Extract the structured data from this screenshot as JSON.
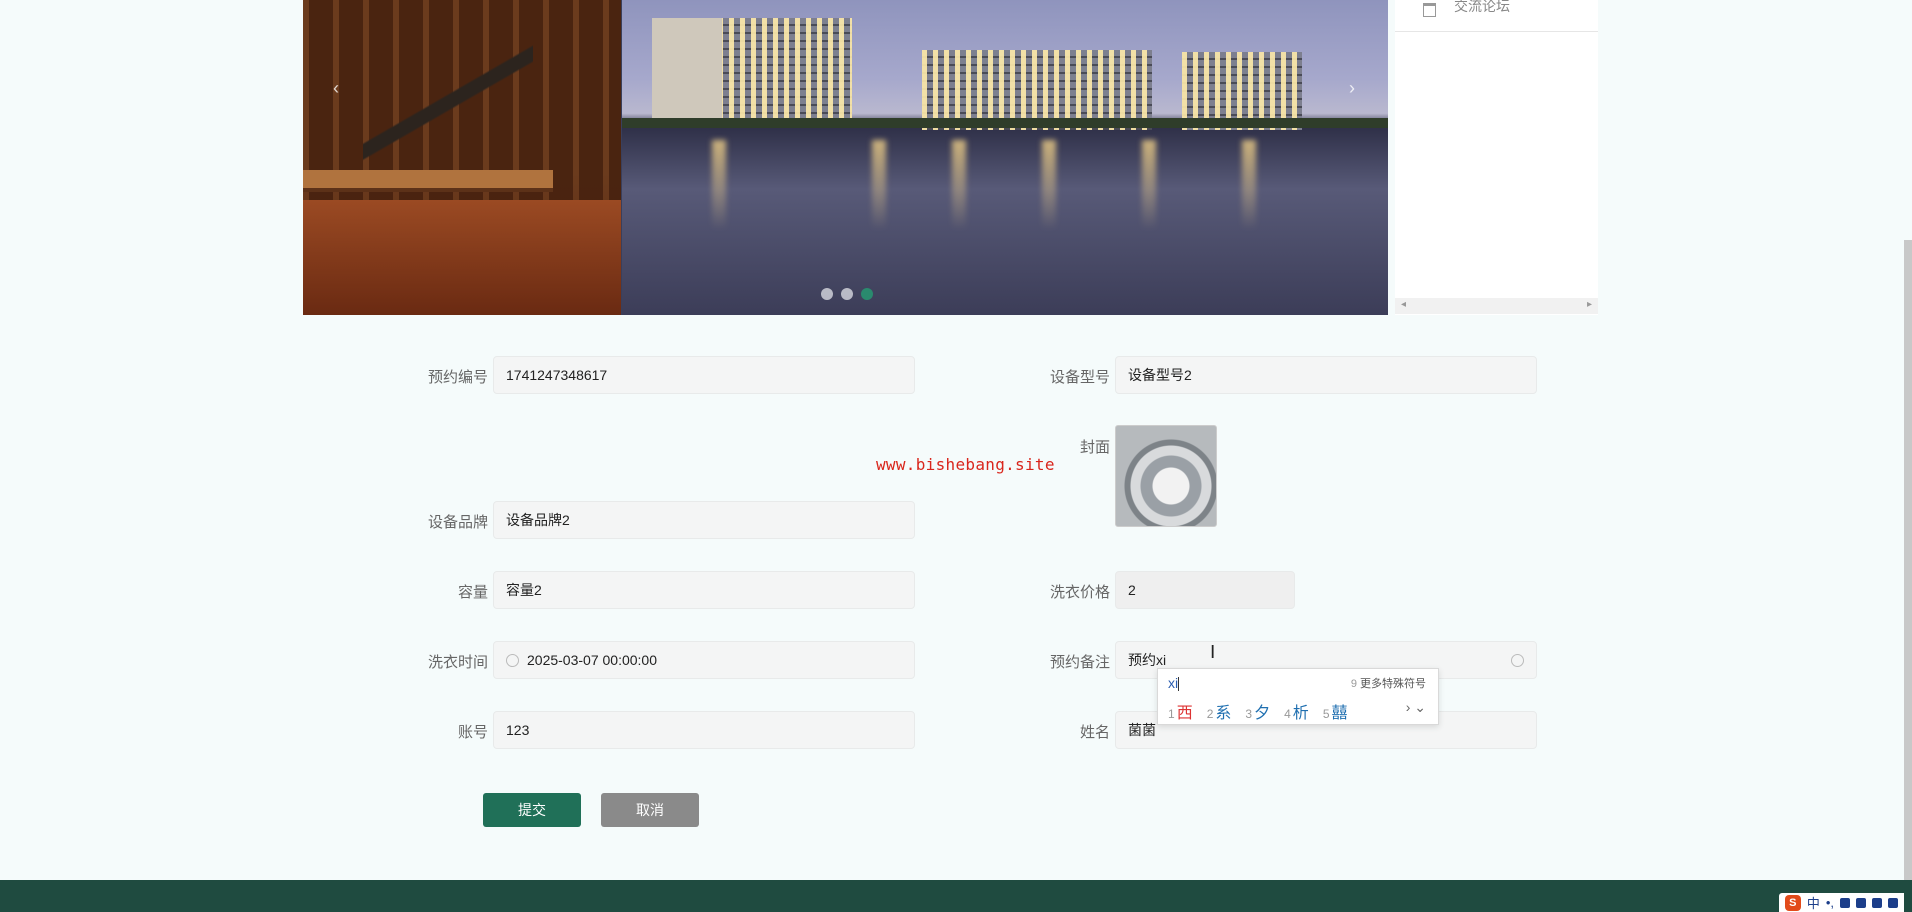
{
  "side_menu": {
    "item_label": "交流论坛"
  },
  "form": {
    "booking_no_label": "预约编号",
    "booking_no_value": "1741247348617",
    "model_label": "设备型号",
    "model_value": "设备型号2",
    "cover_label": "封面",
    "brand_label": "设备品牌",
    "brand_value": "设备品牌2",
    "capacity_label": "容量",
    "capacity_value": "容量2",
    "price_label": "洗衣价格",
    "price_value": "2",
    "wash_time_label": "洗衣时间",
    "wash_time_value": "2025-03-07 00:00:00",
    "note_label": "预约备注",
    "note_value": "预约xi",
    "account_label": "账号",
    "account_value": "123",
    "name_label": "姓名",
    "name_value": "菌菌",
    "submit_label": "提交",
    "cancel_label": "取消"
  },
  "watermark": "www.bishebang.site",
  "ime": {
    "pinyin": "xi",
    "special_num": "9",
    "special_label": "更多特殊符号",
    "candidates": [
      {
        "num": "1",
        "text": "西"
      },
      {
        "num": "2",
        "text": "系"
      },
      {
        "num": "3",
        "text": "夕"
      },
      {
        "num": "4",
        "text": "析"
      },
      {
        "num": "5",
        "text": "囍"
      }
    ]
  },
  "carousel": {
    "slide_count": 3,
    "active_slide": 3
  },
  "tray": {
    "ime_mode": "中"
  },
  "colors": {
    "primary": "#207058",
    "cancel": "#8a8a8a",
    "footer": "#1f4b40",
    "watermark": "#d9261c"
  }
}
